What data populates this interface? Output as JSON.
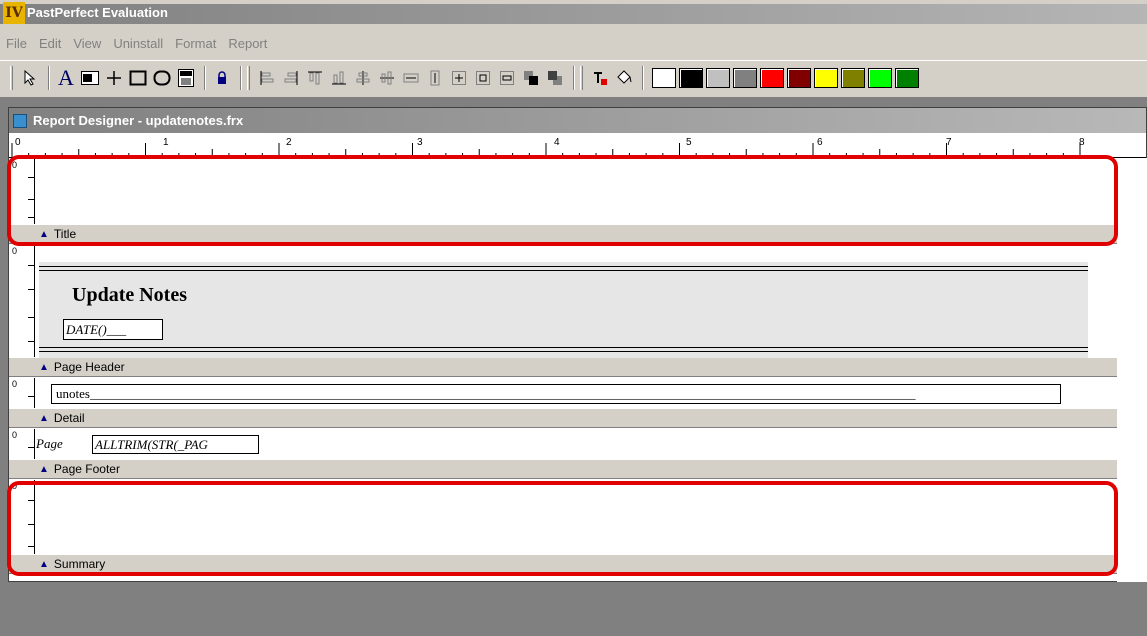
{
  "app": {
    "logo": "IV",
    "title": "PastPerfect Evaluation"
  },
  "menu": {
    "items": [
      "File",
      "Edit",
      "View",
      "Uninstall",
      "Format",
      "Report"
    ]
  },
  "toolbar": {
    "tools": [
      "pointer-icon",
      "label-tool-icon",
      "field-tool-icon",
      "line-tool-icon",
      "rectangle-tool-icon",
      "rounded-rectangle-tool-icon",
      "picture-ole-icon",
      "lock-icon"
    ],
    "layout_buttons": [
      "align-left-icon",
      "align-right-icon",
      "align-top-icon",
      "align-bottom-icon",
      "center-vertical-icon",
      "center-horizontal-icon",
      "same-width-icon",
      "same-height-icon",
      "same-size-icon",
      "center-horizontally-icon",
      "center-vertically-icon",
      "bring-to-front-icon",
      "send-to-back-icon"
    ],
    "color_buttons": [
      "foreground-color-icon",
      "background-fill-icon"
    ],
    "swatches": [
      "#ffffff",
      "#000000",
      "#c0c0c0",
      "#808080",
      "#ff0000",
      "#800000",
      "#ffff00",
      "#808000",
      "#00ff00",
      "#008000"
    ]
  },
  "designer": {
    "title": "Report Designer - updatenotes.frx",
    "ruler_labels": [
      "0",
      "1",
      "2",
      "3",
      "4",
      "5",
      "6",
      "7",
      "8"
    ],
    "bands": {
      "title": "Title",
      "page_header": "Page Header",
      "detail": "Detail",
      "page_footer": "Page Footer",
      "summary": "Summary"
    },
    "vruler_zero": "0",
    "header_text": "Update Notes",
    "date_field": "DATE()___",
    "detail_field": "unotes_______________________________________________________________________________________________________________________________",
    "page_label": "Page",
    "page_field": "ALLTRIM(STR(_PAG"
  },
  "colors": {
    "highlight": "#e00000",
    "band": "#d4d0c8",
    "band_arrow": "#000080"
  }
}
